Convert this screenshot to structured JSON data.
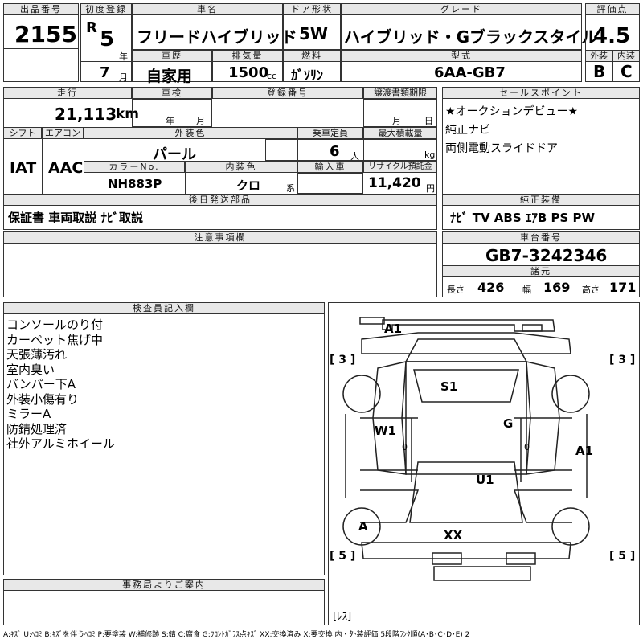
{
  "lot": {
    "label": "出品番号",
    "value": "2155"
  },
  "first_reg": {
    "label": "初度登録",
    "era": "R",
    "year": "5",
    "year_unit": "年",
    "month": "7",
    "month_unit": "月"
  },
  "car_name": {
    "label": "車名",
    "value": "フリードハイブリッド"
  },
  "door": {
    "label": "ドア形状",
    "value": "5W"
  },
  "grade": {
    "label": "グレード",
    "value": "ハイブリッド・Gブラックスタイル"
  },
  "score": {
    "label": "評価点",
    "value": "4.5",
    "ext_label": "外装",
    "ext": "B",
    "int_label": "内装",
    "int": "C"
  },
  "history": {
    "label": "車歴",
    "value": "自家用"
  },
  "displacement": {
    "label": "排気量",
    "value": "1500",
    "unit": "cc"
  },
  "fuel": {
    "label": "燃料",
    "value": "ｶﾞｿﾘﾝ"
  },
  "model": {
    "label": "型式",
    "value": "6AA-GB7"
  },
  "mileage": {
    "label": "走行",
    "value": "21,113",
    "unit": "km"
  },
  "inspection": {
    "label": "車検",
    "year_unit": "年",
    "month_unit": "月"
  },
  "reg_no": {
    "label": "登録番号"
  },
  "transfer": {
    "label": "譲渡書類期限",
    "month_unit": "月",
    "day_unit": "日"
  },
  "shift": {
    "label": "シフト",
    "value": "IAT"
  },
  "ac": {
    "label": "エアコン",
    "value": "AAC"
  },
  "ext_color": {
    "label": "外装色",
    "value": "パール"
  },
  "capacity": {
    "label": "乗車定員",
    "value": "6",
    "unit": "人"
  },
  "max_load": {
    "label": "最大積載量",
    "unit": "kg"
  },
  "color_no": {
    "label": "カラーNo.",
    "value": "NH883P"
  },
  "int_color": {
    "label": "内装色",
    "value": "クロ",
    "suffix": "系"
  },
  "import": {
    "label": "輸入車"
  },
  "recycle": {
    "label": "リサイクル預託金",
    "value": "11,420",
    "unit": "円"
  },
  "later_parts": {
    "label": "後日発送部品",
    "value": "保証書 車両取説 ﾅﾋﾞ取説"
  },
  "sales_points": {
    "label": "セールスポイント",
    "items": [
      "★オークションデビュー★",
      "純正ナビ",
      "両側電動スライドドア"
    ]
  },
  "equipment": {
    "label": "純正装備",
    "value": "ﾅﾋﾞ TV ABS ｴｱB PS PW"
  },
  "notes": {
    "label": "注意事項欄"
  },
  "chassis": {
    "label": "車台番号",
    "value": "GB7-3242346"
  },
  "specs": {
    "label": "諸元",
    "len_label": "長さ",
    "len": "426",
    "wid_label": "幅",
    "wid": "169",
    "hei_label": "高さ",
    "hei": "171"
  },
  "inspector": {
    "label": "検査員記入欄",
    "lines": [
      "コンソールのり付",
      "カーペット焦げ中",
      "天張薄汚れ",
      "室内臭い",
      "バンパー下A",
      "外装小傷有り",
      "ミラーA",
      "防錆処理済",
      "社外アルミホイール"
    ]
  },
  "office": {
    "label": "事務局よりご案内"
  },
  "diagram": {
    "marks": [
      "A1",
      "S1",
      "W1",
      "G",
      "A1",
      "U1",
      "A",
      "XX"
    ],
    "tire_tl": "[ 3 ]",
    "tire_tr": "[ 3 ]",
    "tire_bl": "[ 5 ]",
    "tire_br": "[ 5 ]",
    "zero": "0",
    "spare": "[ﾚｽ]"
  },
  "legend": "A:ｷｽﾞ U:ﾍｺﾐ B:ｷｽﾞを伴うﾍｺﾐ P:要塗装 W:補修跡 S:錆 C:腐食 G:ﾌﾛﾝﾄｶﾞﾗｽ点ｷｽﾞ XX:交換済み X:要交換 内・外装評価 5段階ﾗﾝｸ順(A･B･C･D･E) 2"
}
